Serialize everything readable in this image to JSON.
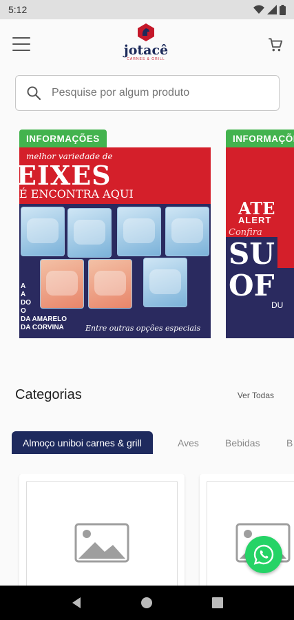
{
  "statusbar": {
    "time": "5:12"
  },
  "header": {
    "logo_text": "jotacê",
    "logo_sub": "CARNES & GRILL"
  },
  "search": {
    "placeholder": "Pesquise por algum produto"
  },
  "banners": [
    {
      "badge": "INFORMAÇÕES",
      "tagline": "melhor variedade de",
      "headline": "EIXES",
      "subline": "É ENCONTRA AQUI",
      "side_lines": [
        "A",
        "A",
        "DO",
        "O"
      ],
      "bottom_lines": [
        "DA AMARELO",
        "DA CORVINA"
      ],
      "footer": "Entre outras opções especiais"
    },
    {
      "badge": "INFORMAÇÕES",
      "line1": "ATE",
      "line2": "ALERT",
      "line3": "Confira",
      "line4": "SU",
      "line5": "OF",
      "line6": "DU"
    }
  ],
  "categories": {
    "title": "Categorias",
    "see_all": "Ver Todas",
    "tabs": [
      {
        "label": "Almoço uniboi carnes & grill",
        "active": true
      },
      {
        "label": "Aves",
        "active": false
      },
      {
        "label": "Bebidas",
        "active": false
      },
      {
        "label": "B",
        "active": false
      }
    ]
  },
  "colors": {
    "brand_navy": "#1e2a5e",
    "brand_red": "#c4182a",
    "badge_green": "#43b34e",
    "whatsapp_green": "#25d366"
  },
  "icons": [
    "menu-icon",
    "cart-icon",
    "search-icon",
    "image-placeholder-icon",
    "whatsapp-icon",
    "back-icon",
    "home-icon",
    "recents-icon"
  ]
}
